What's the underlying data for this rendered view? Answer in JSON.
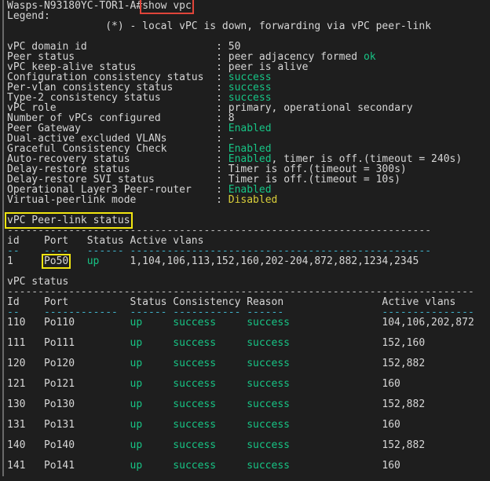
{
  "prompt": {
    "host": "Wasps-N93180YC-TOR1-A#",
    "command": "show vpc"
  },
  "legend": {
    "title": "Legend:",
    "text": "(*) - local vPC is down, forwarding via vPC peer-link"
  },
  "summary": [
    {
      "label": "vPC domain id",
      "parts": [
        [
          "50",
          ""
        ]
      ]
    },
    {
      "label": "Peer status",
      "parts": [
        [
          "peer adjacency formed ",
          ""
        ],
        [
          "ok",
          "g"
        ]
      ]
    },
    {
      "label": "vPC keep-alive status",
      "parts": [
        [
          "peer is alive",
          ""
        ]
      ]
    },
    {
      "label": "Configuration consistency status",
      "parts": [
        [
          "success",
          "g"
        ]
      ]
    },
    {
      "label": "Per-vlan consistency status",
      "parts": [
        [
          "success",
          "g"
        ]
      ]
    },
    {
      "label": "Type-2 consistency status",
      "parts": [
        [
          "success",
          "g"
        ]
      ]
    },
    {
      "label": "vPC role",
      "parts": [
        [
          "primary, operational secondary",
          ""
        ]
      ]
    },
    {
      "label": "Number of vPCs configured",
      "parts": [
        [
          "8",
          ""
        ]
      ]
    },
    {
      "label": "Peer Gateway",
      "parts": [
        [
          "Enabled",
          "g"
        ]
      ]
    },
    {
      "label": "Dual-active excluded VLANs",
      "parts": [
        [
          "-",
          ""
        ]
      ]
    },
    {
      "label": "Graceful Consistency Check",
      "parts": [
        [
          "Enabled",
          "g"
        ]
      ]
    },
    {
      "label": "Auto-recovery status",
      "parts": [
        [
          "Enabled",
          "g"
        ],
        [
          ", timer is off.(timeout = 240s)",
          ""
        ]
      ]
    },
    {
      "label": "Delay-restore status",
      "parts": [
        [
          "Timer is off.(timeout = 300s)",
          ""
        ]
      ]
    },
    {
      "label": "Delay-restore SVI status",
      "parts": [
        [
          "Timer is off.(timeout = 10s)",
          ""
        ]
      ]
    },
    {
      "label": "Operational Layer3 Peer-router",
      "parts": [
        [
          "Enabled",
          "g"
        ]
      ]
    },
    {
      "label": "Virtual-peerlink mode",
      "parts": [
        [
          "Disabled",
          "y"
        ]
      ]
    }
  ],
  "peer_link": {
    "title": "vPC Peer-link status",
    "rule": "---------------------------------------------------------------------",
    "headers": [
      "id",
      "Port",
      "Status",
      "Active vlans"
    ],
    "underlines": [
      "--",
      "----",
      "------",
      "-------------------------------------------------"
    ],
    "rows": [
      {
        "id": "1",
        "port": "Po50",
        "status": "up",
        "vlans": "1,104,106,113,152,160,202-204,872,882,1234,2345"
      }
    ]
  },
  "vpc_status": {
    "title": "vPC status",
    "rule": "----------------------------------------------------------------------------",
    "headers": [
      "Id",
      "Port",
      "Status",
      "Consistency",
      "Reason",
      "Active vlans"
    ],
    "underlines": [
      "--",
      "------------",
      "------",
      "-----------",
      "------",
      "---------------"
    ],
    "rows": [
      {
        "id": "110",
        "port": "Po110",
        "status": "up",
        "consistency": "success",
        "reason": "success",
        "vlans": "104,106,202,872"
      },
      {
        "id": "111",
        "port": "Po111",
        "status": "up",
        "consistency": "success",
        "reason": "success",
        "vlans": "152,160"
      },
      {
        "id": "120",
        "port": "Po120",
        "status": "up",
        "consistency": "success",
        "reason": "success",
        "vlans": "152,882"
      },
      {
        "id": "121",
        "port": "Po121",
        "status": "up",
        "consistency": "success",
        "reason": "success",
        "vlans": "160"
      },
      {
        "id": "130",
        "port": "Po130",
        "status": "up",
        "consistency": "success",
        "reason": "success",
        "vlans": "152,882"
      },
      {
        "id": "131",
        "port": "Po131",
        "status": "up",
        "consistency": "success",
        "reason": "success",
        "vlans": "160"
      },
      {
        "id": "140",
        "port": "Po140",
        "status": "up",
        "consistency": "success",
        "reason": "success",
        "vlans": "152,882"
      },
      {
        "id": "141",
        "port": "Po141",
        "status": "up",
        "consistency": "success",
        "reason": "success",
        "vlans": "160"
      }
    ]
  },
  "colors": {
    "background": "#1e1e1e",
    "text": "#d6d6d6",
    "success": "#17c485",
    "warning": "#d9cf3a",
    "highlight_red": "#e0453a",
    "highlight_yellow": "#f1e510"
  }
}
